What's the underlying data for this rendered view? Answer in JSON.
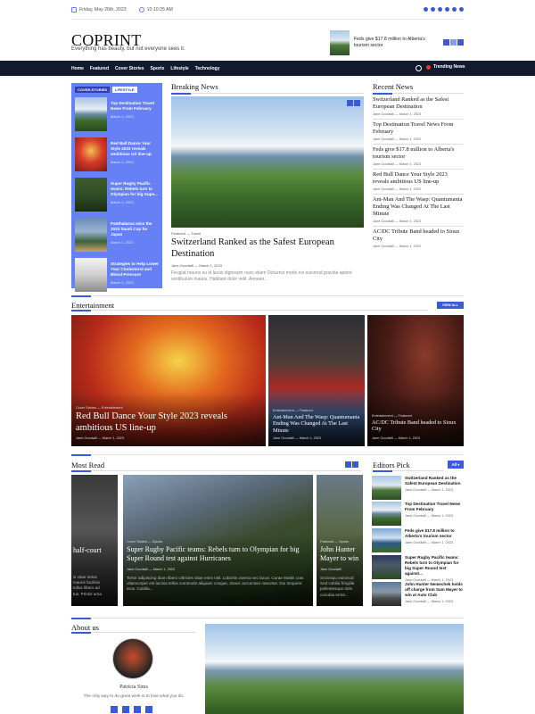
{
  "topbar": {
    "date": "Friday, May 26th, 2023",
    "time": "10:10:25 AM",
    "social_icons": [
      "facebook-icon",
      "instagram-icon",
      "twitter-icon",
      "vimeo-icon",
      "skype-icon",
      "youtube-icon"
    ]
  },
  "brand": {
    "title": "COPRINT",
    "tagline": "Everything has beauty, but not everyone sees it."
  },
  "header_news": {
    "title": "Feds give $17.8 million to Alberta's tourism sector"
  },
  "nav": {
    "items": [
      "Home",
      "Featured",
      "Cover Stories",
      "Sports",
      "Lifestyle",
      "Technology"
    ],
    "trending_label": "Trending News"
  },
  "cover": {
    "tags": [
      "COVER-STORIES",
      "LIFESTYLE"
    ],
    "items": [
      {
        "title": "Top Destination Travel News From February",
        "date": "March 1, 2023"
      },
      {
        "title": "Red Bull Dance Your Style 2023 reveals ambitious US line-up",
        "date": "March 1, 2023"
      },
      {
        "title": "Super Rugby Pacific teams: Rebels turn to Olympian for big Supe...",
        "date": "March 1, 2023"
      },
      {
        "title": "Panthalassa wins the 2023 Saudi Cup for Japan",
        "date": "March 1, 2023"
      },
      {
        "title": "Strategies to Help Lower Your Cholesterol and Blood Pressure",
        "date": "March 1, 2023"
      }
    ]
  },
  "breaking": {
    "section_title": "Breaking News",
    "category": "Featured — Travel",
    "title": "Switzerland Ranked as the Safest European Destination",
    "author": "Jane Goodwill",
    "date": "March 1, 2023",
    "excerpt": "Feugiat mauris eu id lacus dignissim nunc etiam Dictumst morbi est euismod gravida aptent vestibulum mauris. Habitant dolor velit. Aenean..."
  },
  "recent": {
    "section_title": "Recent News",
    "items": [
      {
        "title": "Switzerland Ranked as the Safest European Destination",
        "meta": "Jane Goodwill — March 1, 2023"
      },
      {
        "title": "Top Destination Travel News From February",
        "meta": "Jane Goodwill — March 1, 2023"
      },
      {
        "title": "Feds give $17.8 million to Alberta's tourism sector",
        "meta": "Jane Goodwill — March 1, 2023"
      },
      {
        "title": "Red Bull Dance Your Style 2023 reveals ambitious US line-up",
        "meta": "Jane Goodwill — March 1, 2023"
      },
      {
        "title": "Ant-Man And The Wasp: Quantumania Ending Was Changed At The Last Minute",
        "meta": "Jane Goodwill — March 1, 2023"
      },
      {
        "title": "AC/DC Tribute Band headed to Sioux City",
        "meta": "Jane Goodwill — March 1, 2023"
      }
    ]
  },
  "entertainment": {
    "section_title": "Entertainment",
    "view_all": "VIEW ALL",
    "cards": [
      {
        "category": "Cover Stories — Entertainment",
        "title": "Red Bull Dance Your Style 2023 reveals ambitious US line-up",
        "meta": "Jane Goodwill — March 1, 2023"
      },
      {
        "category": "Entertainment — Featured",
        "title": "Ant-Man And The Wasp: Quantumania Ending Was Changed At The Last Minute",
        "meta": "Jane Goodwill — March 1, 2023"
      },
      {
        "category": "Entertainment — Featured",
        "title": "AC/DC Tribute Band headed to Sioux City",
        "meta": "Jane Goodwill — March 1, 2023"
      }
    ]
  },
  "most_read": {
    "section_title": "Most Read",
    "cards": [
      {
        "title": "half-court",
        "excerpt": "is vitae netus\nmauris facilisis\ntollus libero ad\ntus. Primis urna"
      },
      {
        "category": "Cover Stories — Sports",
        "title": "Super Rugby Pacific teams: Rebels turn to Olympian for big Super Round test against Hurricanes",
        "meta": "Jane Goodwill — March 1, 2023",
        "excerpt": "Tortor adipiscing diam libero Ultricies vitae enim nisl. Lobortis viverra nec lacus. Curae Mattis cras ullamcorper est lacinia tellus commodo aliquam congue, donec accumsan nascetur. Dui torquent eros. Cubilia..."
      },
      {
        "category": "Featured — Sports",
        "title": "John Hunter Mayer to win",
        "meta": "Jane Goodwill",
        "excerpt": "Sociosqu euismod\nSed cubilia fringilla\npellentesque dolo\nconubia tortor..."
      }
    ]
  },
  "editors_pick": {
    "section_title": "Editors Pick",
    "filter": "All",
    "items": [
      {
        "title": "Switzerland Ranked as the Safest European Destination",
        "meta": "Jane Goodwill — March 1, 2023"
      },
      {
        "title": "Top Destination Travel News From February",
        "meta": "Jane Goodwill — March 1, 2023"
      },
      {
        "title": "Feds give $17.8 million to Alberta's tourism sector",
        "meta": "Jane Goodwill — March 1, 2023"
      },
      {
        "title": "Super Rugby Pacific teams: Rebels turn to Olympian for big Super Round test against...",
        "meta": "Jane Goodwill — March 1, 2023"
      },
      {
        "title": "John Hunter Nemechek holds off charge from Sam Mayer to win at Auto Club",
        "meta": "Jane Goodwill — March 1, 2023"
      }
    ]
  },
  "about": {
    "section_title": "About us",
    "name": "Patricia Sims",
    "bio": "The only way to do great work is to love what you do."
  }
}
